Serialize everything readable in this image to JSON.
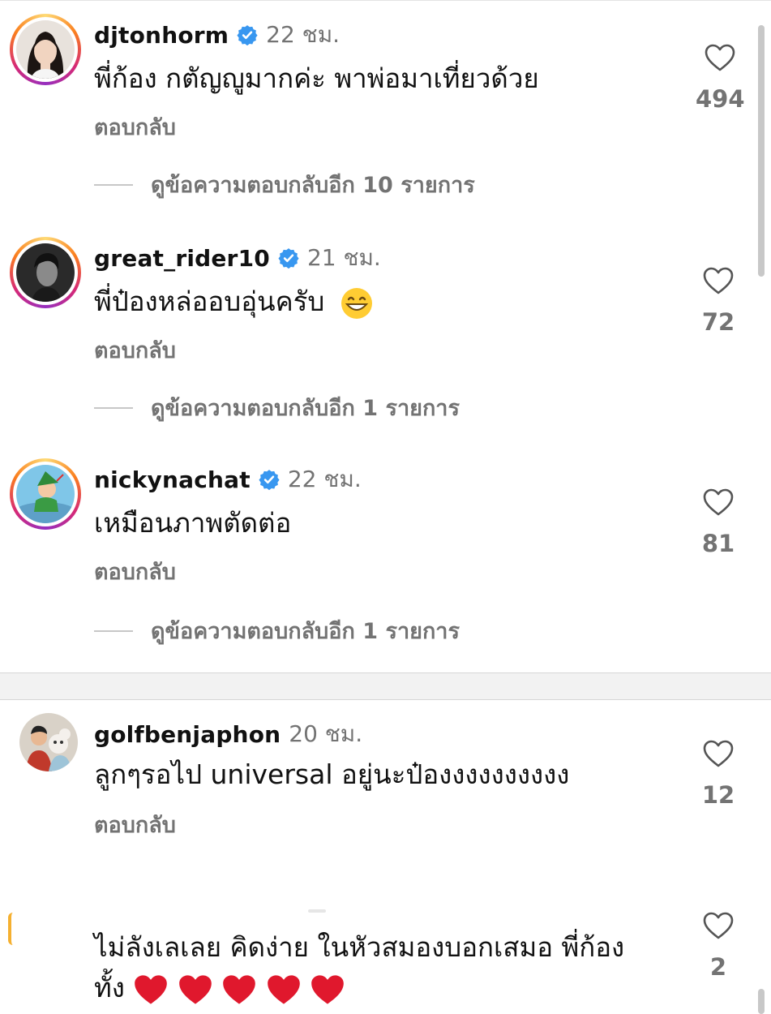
{
  "comments": [
    {
      "username": "djtonhorm",
      "verified": true,
      "time": "22 ชม.",
      "text": "พี่ก้อง กตัญญูมากค่ะ พาพ่อมาเที่ยวด้วย",
      "reply_label": "ตอบกลับ",
      "view_replies": "ดูข้อความตอบกลับอีก 10 รายการ",
      "likes": "494"
    },
    {
      "username": "great_rider10",
      "verified": true,
      "time": "21 ชม.",
      "text": "พี่ป๋องหล่ออบอุ่นครับ",
      "emoji": "grinning-face-icon",
      "reply_label": "ตอบกลับ",
      "view_replies": "ดูข้อความตอบกลับอีก 1 รายการ",
      "likes": "72"
    },
    {
      "username": "nickynachat",
      "verified": true,
      "time": "22 ชม.",
      "text": "เหมือนภาพตัดต่อ",
      "reply_label": "ตอบกลับ",
      "view_replies": "ดูข้อความตอบกลับอีก 1 รายการ",
      "likes": "81"
    },
    {
      "username": "golfbenjaphon",
      "verified": false,
      "time": "20 ชม.",
      "text": "ลูกๆรอไป universal อยู่นะป๋องงงงงงงงงง",
      "reply_label": "ตอบกลับ",
      "likes": "12"
    },
    {
      "text_line1": "ไม่ลังเลเลย คิดง่าย ในหัวสมองบอกเสมอ พี่ก้อง",
      "text_line2": "ทั้ง",
      "emoji": "red-heart-icon",
      "likes": "2"
    }
  ],
  "colors": {
    "verified": "#3897f0",
    "secondary_text": "#737373",
    "heart": "#e0182d"
  }
}
